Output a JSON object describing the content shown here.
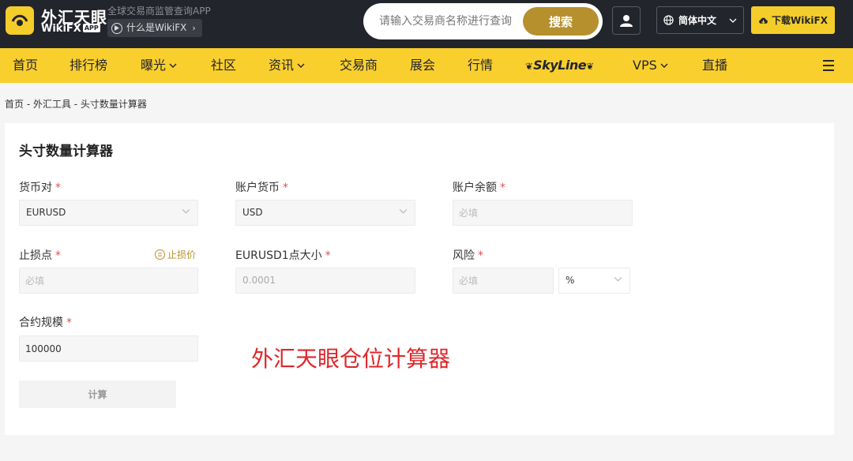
{
  "header": {
    "logo_cn": "外汇天眼",
    "logo_en": "WikiFX",
    "logo_app_tag": "APP",
    "slogan": "全球交易商监管查询APP",
    "what_is": "什么是WikiFX",
    "search_placeholder": "请输入交易商名称进行查询",
    "search_button": "搜索",
    "language": "简体中文",
    "download": "下载WikiFX"
  },
  "nav": {
    "items": [
      "首页",
      "排行榜",
      "曝光",
      "社区",
      "资讯",
      "交易商",
      "展会",
      "行情",
      "SkyLine",
      "VPS",
      "直播"
    ]
  },
  "breadcrumb": "首页 - 外汇工具 - 头寸数量计算器",
  "calculator": {
    "title": "头寸数量计算器",
    "fields": {
      "currency_pair": {
        "label": "货币对",
        "value": "EURUSD"
      },
      "account_currency": {
        "label": "账户货币",
        "value": "USD"
      },
      "account_balance": {
        "label": "账户余额",
        "placeholder": "必填"
      },
      "stop_loss": {
        "label": "止损点",
        "placeholder": "必填",
        "link": "止损价"
      },
      "pip_size": {
        "label": "EURUSD1点大小",
        "value": "0.0001"
      },
      "risk": {
        "label": "风险",
        "placeholder": "必填",
        "unit": "%"
      },
      "contract_size": {
        "label": "合约规模",
        "value": "100000"
      }
    },
    "required_mark": "*",
    "calc_button": "计算"
  },
  "watermark": "外汇天眼仓位计算器",
  "colors": {
    "header_bg": "#23252c",
    "nav_bg": "#f9cf2e",
    "accent_gold": "#b7902e",
    "required_red": "#d9534f",
    "watermark_red": "#e0262a"
  }
}
